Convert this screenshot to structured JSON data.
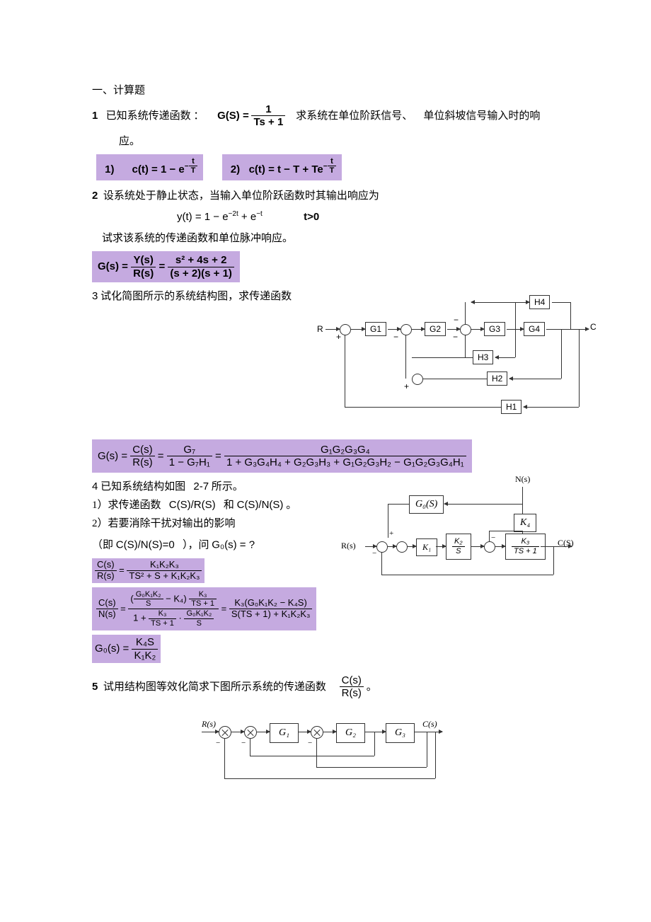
{
  "section_title": "一、计算题",
  "q1": {
    "number": "1",
    "text_before": "已知系统传递函数  ：",
    "tf_lhs": "G(S) =",
    "tf_num": "1",
    "tf_den": "Ts + 1",
    "text_after_1": "求系统在单位阶跃信号、",
    "text_after_2": "单位斜坡信号输入时的响",
    "text_line2": "应。",
    "ans1_label": "1)",
    "ans1_expr_a": "c(t) = 1 − e",
    "ans1_exp_num": "t",
    "ans1_exp_den": "T",
    "ans2_label": "2)",
    "ans2_expr_a": "c(t) = t − T + Te",
    "ans2_exp_num": "t",
    "ans2_exp_den": "T"
  },
  "q2": {
    "number": "2",
    "text_1": "设系统处于静止状态，当输入单位阶跃函数时其输出响应为",
    "resp_lhs": "y(t) = 1 − e",
    "resp_e1": "−2t",
    "resp_plus": " + e",
    "resp_e2": "−t",
    "t_cond": "t>0",
    "text_2": "试求该系统的传递函数和单位脉冲响应。",
    "ans_lhs": "G(s) =",
    "ans_mid_num": "Y(s)",
    "ans_mid_den": "R(s)",
    "ans_r_num": "s² + 4s + 2",
    "ans_r_den": "(s + 2)(s + 1)"
  },
  "q3": {
    "number": "3",
    "text": "试化简图所示的系统结构图，求传递函数",
    "diagram": {
      "in": "R",
      "out": "C",
      "g1": "G1",
      "g2": "G2",
      "g3": "G3",
      "g4": "G4",
      "h1": "H1",
      "h2": "H2",
      "h3": "H3",
      "h4": "H4",
      "plus": "+",
      "minus": "−"
    },
    "ans_lhs": "G(s) =",
    "f1_num": "C(s)",
    "f1_den": "R(s)",
    "f2_num": "G₇",
    "f2_den": "1 − G₇H₁",
    "f3_num": "G₁G₂G₃G₄",
    "f3_den": "1 + G₃G₄H₄ + G₂G₃H₃ + G₁G₂G₃H₂ − G₁G₂G₃G₄H₁"
  },
  "q4": {
    "number": "4",
    "text_1": "已知系统结构如图",
    "fig_ref": "2-7",
    "text_1b": "所示。",
    "text_2a": "1）求传递函数",
    "text_2b": "C(S)/R(S)",
    "text_2c": "和",
    "text_2d": "C(S)/N(S)",
    "text_2e": "。",
    "text_3": "2）若要消除干扰对输出的影响",
    "text_4a": "（即",
    "text_4b": "C(S)/N(S)=0",
    "text_4c": "），问",
    "text_4d": "G₀(s) = ?",
    "diagram": {
      "N": "N(s)",
      "R": "R(s)",
      "C": "C(S)",
      "G0": "G₀(S)",
      "K1": "K₁",
      "K2": "K₂",
      "K2_den": "S",
      "K4": "K₄",
      "K3_num": "K₃",
      "K3_den": "TS + 1",
      "minus": "−"
    },
    "a1_num": "C(s)",
    "a1_den": "R(s)",
    "a1_r_num": "K₁K₂K₃",
    "a1_r_den": "TS² + S + K₁K₂K₃",
    "a2_num": "C(s)",
    "a2_den": "N(s)",
    "a2_m_top_l": "G₀K₁K₂",
    "a2_m_top_l_den": "S",
    "a2_m_top_mid": " − K₄",
    "a2_m_top_r_num": "K₃",
    "a2_m_top_r_den": "TS + 1",
    "a2_m_bot_a": "1 + ",
    "a2_m_bot_b_num": "K₃",
    "a2_m_bot_b_den": "TS + 1",
    "a2_m_bot_c_num": "G₀K₁K₂",
    "a2_m_bot_c_den": "S",
    "a2_r_num": "K₃(G₀K₁K₂ − K₄S)",
    "a2_r_den": "S(TS + 1) + K₁K₂K₃",
    "a3_lhs": "G₀(s) =",
    "a3_num": "K₄S",
    "a3_den": "K₁K₂"
  },
  "q5": {
    "number": "5",
    "text": "试用结构图等效化简求下图所示系统的传递函数",
    "frac_num": "C(s)",
    "frac_den": "R(s)",
    "period": "。",
    "diagram": {
      "R": "R(s)",
      "C": "C(s)",
      "G1": "G₁",
      "G2": "G₂",
      "G3": "G₃",
      "minus": "−"
    }
  }
}
